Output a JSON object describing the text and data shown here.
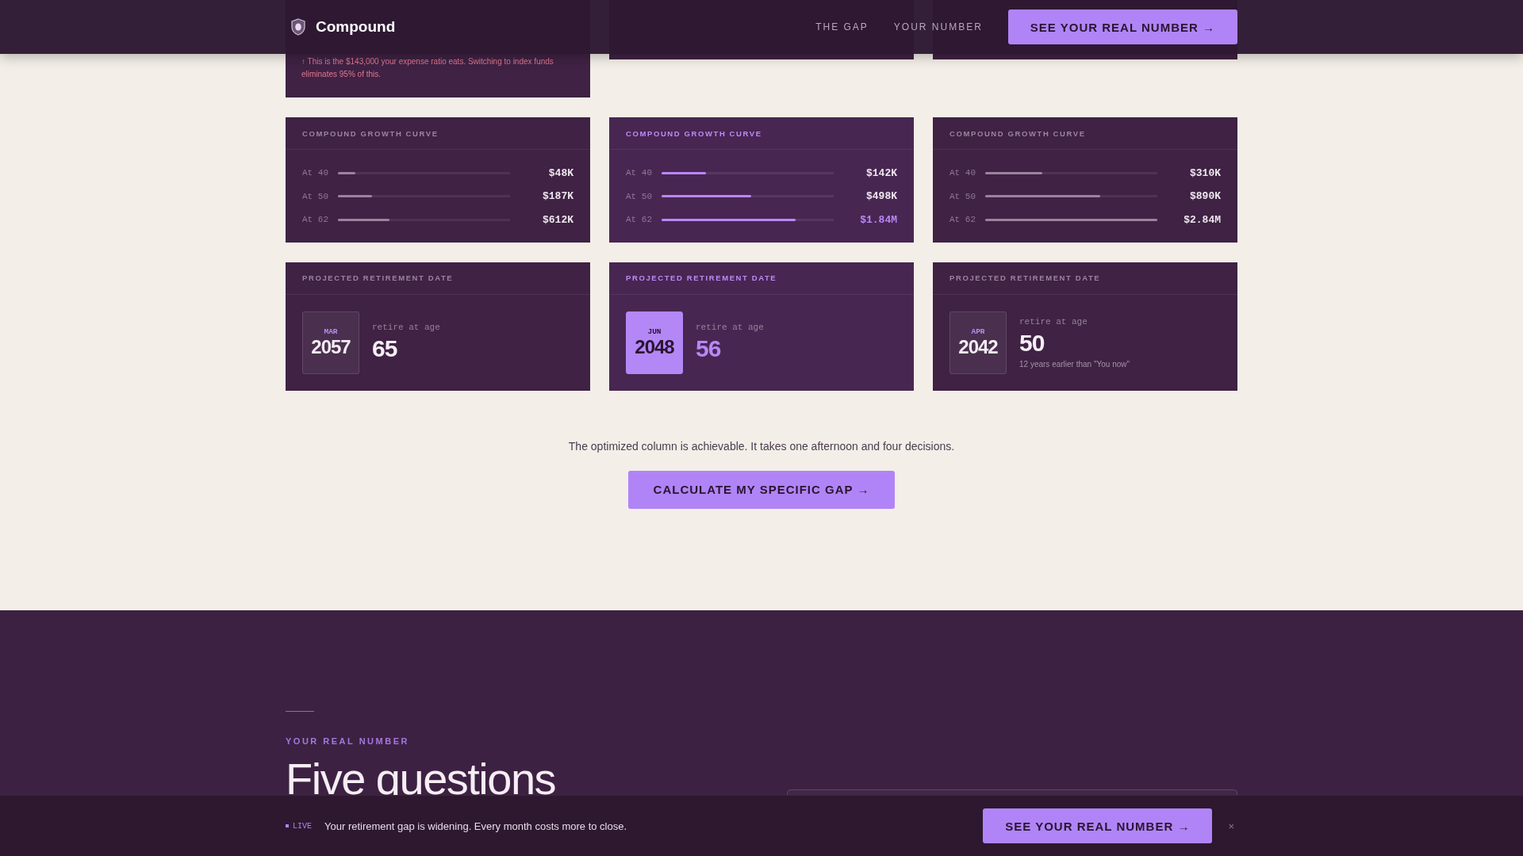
{
  "nav": {
    "brand": "Compound",
    "links": [
      "THE GAP",
      "YOUR NUMBER"
    ],
    "cta": "SEE YOUR REAL NUMBER →"
  },
  "top_note": "↑ This is the $143,000 your expense ratio eats. Switching to index funds eliminates 95% of this.",
  "columns": [
    {
      "highlighted": false,
      "growth": {
        "title": "COMPOUND GROWTH CURVE",
        "rows": [
          {
            "label": "At 40",
            "level": 0.1,
            "value": "$48K",
            "emphasis": false
          },
          {
            "label": "At 50",
            "level": 0.2,
            "value": "$187K",
            "emphasis": false
          },
          {
            "label": "At 62",
            "level": 0.3,
            "value": "$612K",
            "emphasis": false
          }
        ]
      },
      "retirement": {
        "title": "PROJECTED RETIREMENT DATE",
        "month": "MAR",
        "year": "2057",
        "caption": "retire at age",
        "age": "65"
      }
    },
    {
      "highlighted": true,
      "growth": {
        "title": "COMPOUND GROWTH CURVE",
        "rows": [
          {
            "label": "At 40",
            "level": 0.26,
            "value": "$142K",
            "emphasis": false
          },
          {
            "label": "At 50",
            "level": 0.52,
            "value": "$498K",
            "emphasis": false
          },
          {
            "label": "At 62",
            "level": 0.78,
            "value": "$1.84M",
            "emphasis": true
          }
        ]
      },
      "retirement": {
        "title": "PROJECTED RETIREMENT DATE",
        "month": "JUN",
        "year": "2048",
        "caption": "retire at age",
        "age": "56"
      }
    },
    {
      "highlighted": false,
      "growth": {
        "title": "COMPOUND GROWTH CURVE",
        "rows": [
          {
            "label": "At 40",
            "level": 0.33,
            "value": "$310K",
            "emphasis": false
          },
          {
            "label": "At 50",
            "level": 0.67,
            "value": "$890K",
            "emphasis": false
          },
          {
            "label": "At 62",
            "level": 1,
            "value": "$2.84M",
            "emphasis": false
          }
        ]
      },
      "retirement": {
        "title": "PROJECTED RETIREMENT DATE",
        "month": "APR",
        "year": "2042",
        "caption": "retire at age",
        "age": "50",
        "note": "12 years earlier than \"You now\""
      }
    }
  ],
  "summary": "The optimized column is achievable. It takes one afternoon and four decisions.",
  "summary_cta": "CALCULATE MY SPECIFIC GAP →",
  "section": {
    "eyebrow": "YOUR REAL NUMBER",
    "heading": "Five questions"
  },
  "sticky_bar": {
    "badge": "LIVE",
    "message": "Your retirement gap is widening. Every month costs more to close.",
    "cta": "SEE YOUR REAL NUMBER →",
    "close": "×"
  }
}
